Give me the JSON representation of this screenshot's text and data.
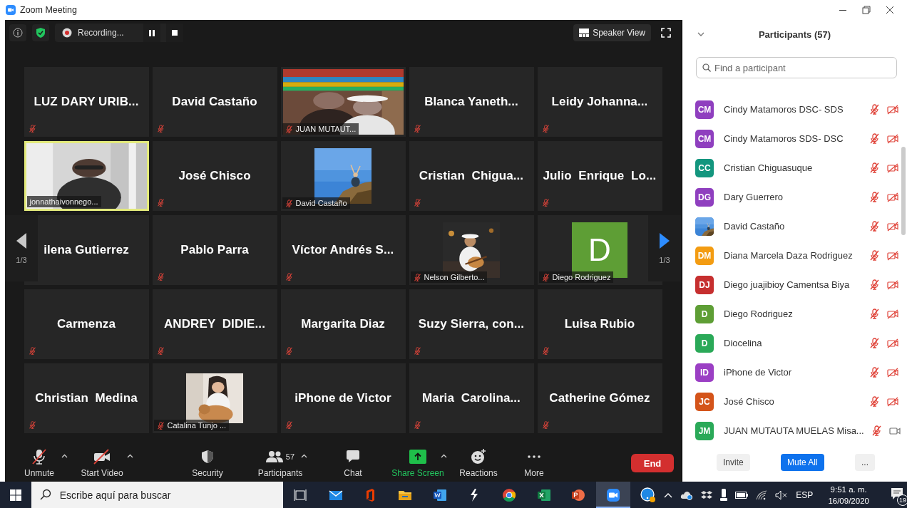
{
  "window": {
    "title": "Zoom Meeting"
  },
  "meeting_bar": {
    "recording": "Recording...",
    "view_button": "Speaker View"
  },
  "tiles": [
    {
      "kind": "name",
      "name": "LUZ DARY URIB...",
      "muted": true,
      "speaking": false
    },
    {
      "kind": "name",
      "name": "David Castaño",
      "muted": true,
      "speaking": false
    },
    {
      "kind": "camera",
      "name": "JUAN MUTAUT...",
      "muted": true,
      "speaking": false
    },
    {
      "kind": "name",
      "name": "Blanca Yaneth...",
      "muted": true,
      "speaking": false
    },
    {
      "kind": "name",
      "name": "Leidy Johanna...",
      "muted": true,
      "speaking": false
    },
    {
      "kind": "camera",
      "name": "jonnathaivonnego...",
      "muted": false,
      "speaking": true
    },
    {
      "kind": "name",
      "name": "José Chisco",
      "muted": true,
      "speaking": false
    },
    {
      "name": "David Castaño",
      "muted": true,
      "speaking": false
    },
    {
      "kind": "name",
      "name": "Cristian  Chigua...",
      "muted": true,
      "speaking": false
    },
    {
      "kind": "name",
      "name": "Julio  Enrique  Lo...",
      "muted": true,
      "speaking": false
    },
    {
      "kind": "name",
      "name": "ilena Gutierrez",
      "muted": false,
      "speaking": false
    },
    {
      "kind": "name",
      "name": "Pablo Parra",
      "muted": true,
      "speaking": false
    },
    {
      "kind": "name",
      "name": "Víctor Andrés S...",
      "muted": true,
      "speaking": false
    },
    {
      "name": "Nelson Gilberto...",
      "muted": true,
      "speaking": false
    },
    {
      "kind": "avatar",
      "name": "Diego Rodriguez",
      "initial": "D",
      "color": "#5e9e35",
      "muted": true,
      "speaking": false
    },
    {
      "kind": "name",
      "name": "Carmenza",
      "muted": true,
      "speaking": false
    },
    {
      "kind": "name",
      "name": "ANDREY  DIDIE...",
      "muted": true,
      "speaking": false
    },
    {
      "kind": "name",
      "name": "Margarita Diaz",
      "muted": true,
      "speaking": false
    },
    {
      "kind": "name",
      "name": "Suzy Sierra, con...",
      "muted": true,
      "speaking": false
    },
    {
      "kind": "name",
      "name": "Luisa Rubio",
      "muted": true,
      "speaking": false
    },
    {
      "kind": "name",
      "name": "Christian  Medina",
      "muted": true,
      "speaking": false
    },
    {
      "name": "Catalina Tunjo ...",
      "muted": true,
      "speaking": false
    },
    {
      "kind": "name",
      "name": "iPhone de Victor",
      "muted": true,
      "speaking": false
    },
    {
      "kind": "name",
      "name": "Maria  Carolina...",
      "muted": true,
      "speaking": false
    },
    {
      "kind": "name",
      "name": "Catherine Gómez",
      "muted": true,
      "speaking": false
    }
  ],
  "pager": {
    "left": "1/3",
    "right": "1/3"
  },
  "toolbar": [
    {
      "kind": "mic",
      "label": "Unmute",
      "caret": true
    },
    {
      "kind": "video",
      "label": "Start Video",
      "caret": true
    },
    {
      "kind": "security",
      "label": "Security",
      "caret": false
    },
    {
      "kind": "participants",
      "label": "Participants",
      "count": "57",
      "caret": true
    },
    {
      "kind": "chat",
      "label": "Chat",
      "caret": false
    },
    {
      "kind": "share",
      "label": "Share Screen",
      "caret": true
    },
    {
      "kind": "reactions",
      "label": "Reactions",
      "caret": false
    },
    {
      "kind": "more",
      "label": "More",
      "caret": false
    }
  ],
  "end_button": "End",
  "participants_panel": {
    "title": "Participants (57)",
    "search": {
      "placeholder": "Find a participant"
    },
    "participants": [
      {
        "kind": "initials",
        "name": "Cindy Matamoros DSC- SDS",
        "initials": "CM",
        "color": "#8f3fbf",
        "mic_muted": true,
        "video_off": true
      },
      {
        "kind": "initials",
        "name": "Cindy Matamoros SDS- DSC",
        "initials": "CM",
        "color": "#8f3fbf",
        "mic_muted": true,
        "video_off": true
      },
      {
        "kind": "initials",
        "name": "Cristian Chiguasuque",
        "initials": "CC",
        "color": "#13967e",
        "mic_muted": true,
        "video_off": true
      },
      {
        "kind": "initials",
        "name": "Dary Guerrero",
        "initials": "DG",
        "color": "#8f3fbf",
        "mic_muted": true,
        "video_off": true
      },
      {
        "name": "David Castaño",
        "mic_muted": true,
        "video_off": true
      },
      {
        "kind": "initials",
        "name": "Diana Marcela Daza Rodriguez",
        "initials": "DM",
        "color": "#f39c12",
        "mic_muted": true,
        "video_off": true
      },
      {
        "kind": "initials",
        "name": "Diego juajibioy Camentsa Biya",
        "initials": "DJ",
        "color": "#c62f2f",
        "mic_muted": true,
        "video_off": true
      },
      {
        "kind": "initials",
        "name": "Diego Rodriguez",
        "initials": "D",
        "color": "#5e9e35",
        "mic_muted": true,
        "video_off": true
      },
      {
        "kind": "initials",
        "name": "Diocelina",
        "initials": "D",
        "color": "#2aa958",
        "mic_muted": true,
        "video_off": true
      },
      {
        "kind": "initials",
        "name": "iPhone de Victor",
        "initials": "ID",
        "color": "#9b3fc4",
        "mic_muted": true,
        "video_off": true
      },
      {
        "kind": "initials",
        "name": "José Chisco",
        "initials": "JC",
        "color": "#d4541a",
        "mic_muted": true,
        "video_off": true
      },
      {
        "kind": "initials",
        "name": "JUAN MUTAUTA MUELAS Misa...",
        "initials": "JM",
        "color": "#2aa958",
        "mic_muted": true,
        "video_off": false
      }
    ],
    "buttons": [
      {
        "kind": "plain",
        "label": "Invite"
      },
      {
        "kind": "primary",
        "label": "Mute All"
      },
      {
        "kind": "plain",
        "label": "..."
      }
    ]
  },
  "taskbar": {
    "search_placeholder": "Escribe aquí para buscar",
    "language": "ESP",
    "time": "9:51 a. m.",
    "date": "16/09/2020",
    "notifications": "19"
  }
}
